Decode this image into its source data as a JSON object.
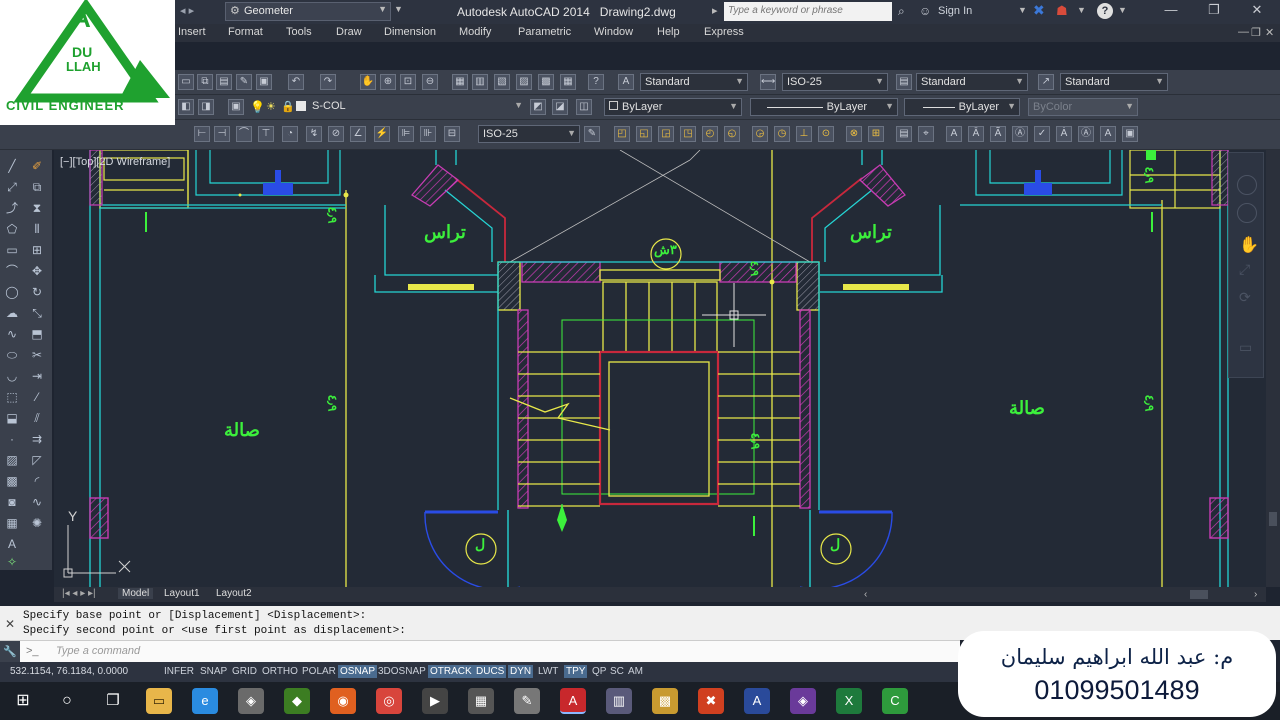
{
  "titlebar": {
    "workspace": "Geometer",
    "app_title": "Autodesk AutoCAD 2014",
    "document": "Drawing2.dwg",
    "search_placeholder": "Type a keyword or phrase",
    "signin": "Sign In"
  },
  "menu": [
    "Insert",
    "Format",
    "Tools",
    "Draw",
    "Dimension",
    "Modify",
    "Parametric",
    "Window",
    "Help",
    "Express"
  ],
  "toolbar_styles": {
    "text_style": "Standard",
    "dim_style": "ISO-25",
    "table_style": "Standard",
    "mleader_style": "Standard"
  },
  "toolbar_layers": {
    "layer": "S-COL",
    "color": "ByLayer",
    "linetype": "ByLayer",
    "lineweight": "ByLayer",
    "plot_style": "ByColor"
  },
  "toolbar_dim": {
    "dim_style": "ISO-25"
  },
  "viewport": {
    "label": "[−][Top][2D Wireframe]"
  },
  "drawing_labels": {
    "terrace": "تراس",
    "hall": "صالة",
    "stair_tag": "٣ش",
    "elevator_tag": "ل",
    "dim_vertical": "٤٫٩",
    "axis_y": "Y"
  },
  "layout_tabs": [
    "Model",
    "Layout1",
    "Layout2"
  ],
  "command_history": [
    "Specify base point or [Displacement] <Displacement>:",
    "Specify second point or <use first point as displacement>:"
  ],
  "command_placeholder": "Type a command",
  "status": {
    "coords": "532.1154, 76.1184, 0.0000",
    "buttons": [
      {
        "label": "INFER",
        "on": false
      },
      {
        "label": "SNAP",
        "on": false
      },
      {
        "label": "GRID",
        "on": false
      },
      {
        "label": "ORTHO",
        "on": false
      },
      {
        "label": "POLAR",
        "on": false
      },
      {
        "label": "OSNAP",
        "on": true
      },
      {
        "label": "3DOSNAP",
        "on": false
      },
      {
        "label": "OTRACK",
        "on": true
      },
      {
        "label": "DUCS",
        "on": true
      },
      {
        "label": "DYN",
        "on": true
      },
      {
        "label": "LWT",
        "on": false
      },
      {
        "label": "TPY",
        "on": true
      },
      {
        "label": "QP",
        "on": false
      },
      {
        "label": "SC",
        "on": false
      },
      {
        "label": "AM",
        "on": false
      }
    ]
  },
  "logo": {
    "letter": "A",
    "line1": "DU",
    "line2": "LLAH",
    "caption": "CIVIL ENGINEER",
    "color": "#1fa12f"
  },
  "signature": {
    "name": "م: عبد الله ابراهيم سليمان",
    "phone": "01099501489"
  },
  "colors": {
    "wall_cyan": "#24d4d4",
    "text_green": "#3cf03c",
    "stair_yellow": "#e8e84a",
    "wall_red": "#c8283c",
    "hatch_magenta": "#c83cb4",
    "door_blue": "#2a4ce6"
  },
  "taskbar_apps": [
    "windows-start",
    "cortana",
    "task-view",
    "file-explorer",
    "ie",
    "vlc",
    "access",
    "firefox",
    "chrome",
    "media",
    "calculator",
    "paint",
    "autocad",
    "app",
    "app",
    "autocad-360",
    "app",
    "vs",
    "excel",
    "green-app"
  ]
}
